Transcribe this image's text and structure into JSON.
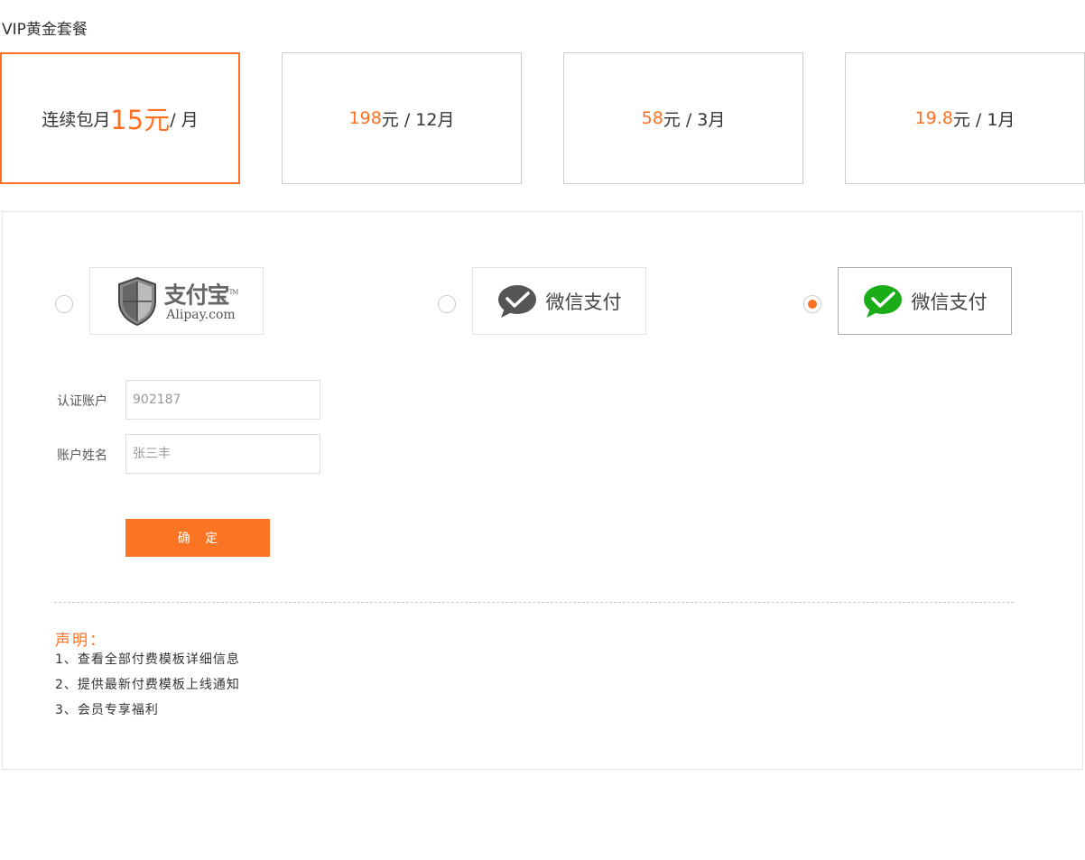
{
  "page_title": "VIP黄金套餐",
  "plans": [
    {
      "prefix": "连续包月",
      "price": "15元",
      "suffix": " / 月",
      "selected": true
    },
    {
      "prefix": "",
      "price": "198",
      "suffix": "元 / 12月",
      "selected": false
    },
    {
      "prefix": "",
      "price": "58",
      "suffix": "元 / 3月",
      "selected": false
    },
    {
      "prefix": "",
      "price": "19.8",
      "suffix": "元 / 1月",
      "selected": false
    }
  ],
  "payment": {
    "options": [
      {
        "name": "alipay",
        "label_cn": "支付宝",
        "label_tm": "TM",
        "label_en": "Alipay.com",
        "icon": "alipay-shield-icon",
        "selected": false,
        "color": "#666666"
      },
      {
        "name": "wechat-gray",
        "label": "微信支付",
        "icon": "wechat-icon",
        "selected": false,
        "color": "#555555"
      },
      {
        "name": "wechat-green",
        "label": "微信支付",
        "icon": "wechat-icon",
        "selected": true,
        "color": "#1aad19"
      }
    ]
  },
  "form": {
    "account_label": "认证账户",
    "account_placeholder": "902187",
    "name_label": "账户姓名",
    "name_placeholder": "张三丰",
    "confirm_label": "确 定"
  },
  "notice": {
    "title": "声明：",
    "items": [
      "1、查看全部付费模板详细信息",
      "2、提供最新付费模板上线通知",
      "3、会员专享福利"
    ]
  },
  "colors": {
    "accent": "#ff7020",
    "button": "#fa7423",
    "wechat_green": "#1aad19"
  }
}
